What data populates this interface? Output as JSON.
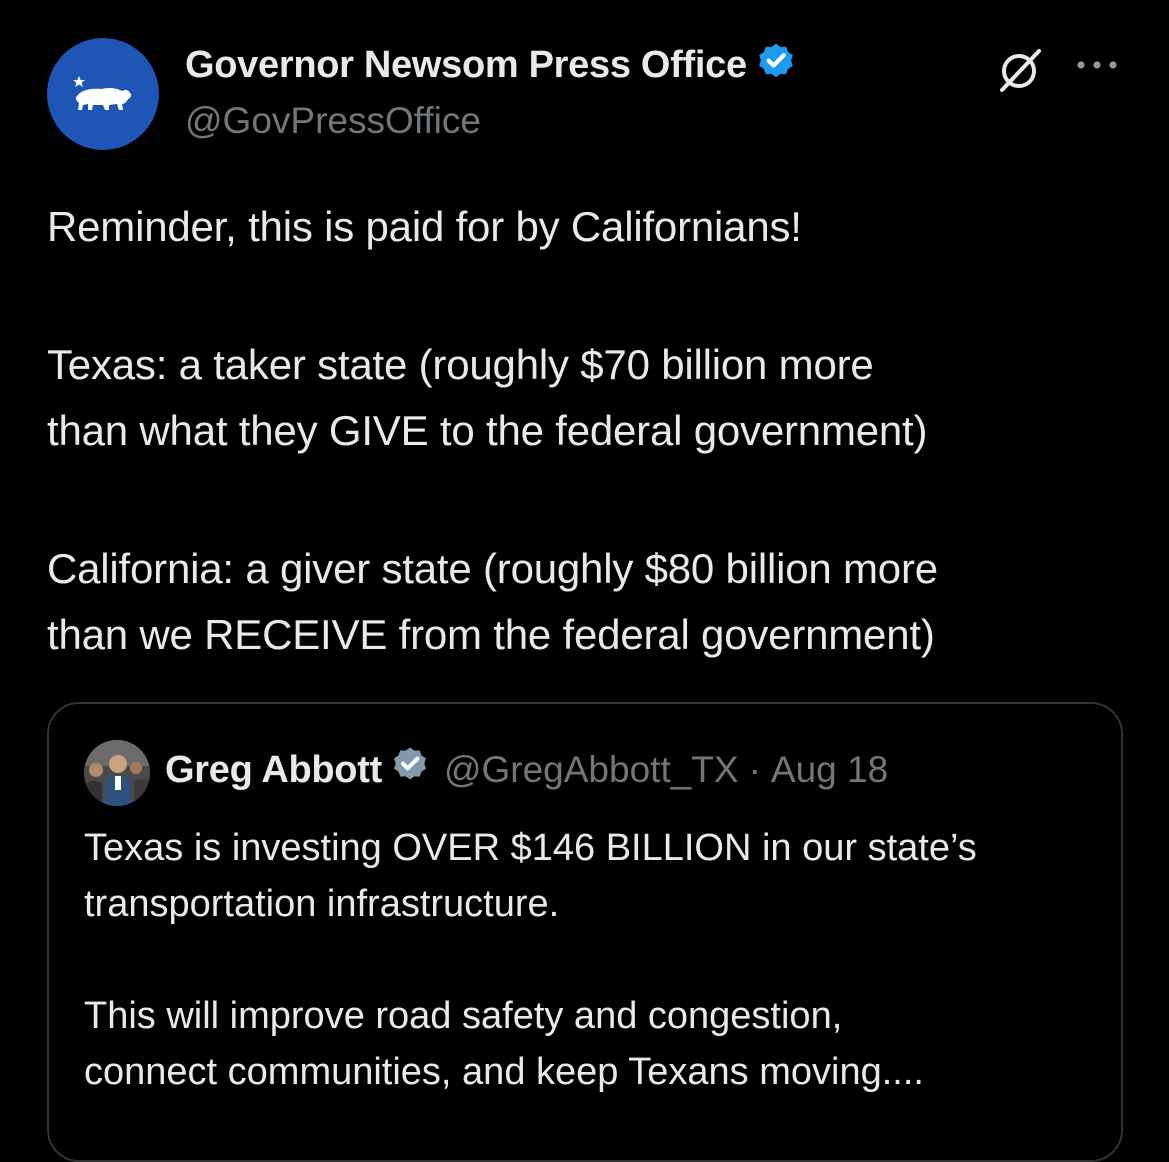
{
  "author": {
    "display_name": "Governor Newsom Press Office",
    "handle": "@GovPressOffice"
  },
  "tweet": {
    "lines": [
      "Reminder, this is paid for by Californians!",
      "Texas: a taker state (roughly $70 billion more",
      "than what they GIVE to the federal government)",
      "California: a giver state (roughly $80 billion more",
      "than we RECEIVE from the federal government)"
    ]
  },
  "quote": {
    "display_name": "Greg Abbott",
    "handle": "@GregAbbott_TX",
    "separator": "·",
    "date": "Aug 18",
    "lines": [
      "Texas is investing OVER $146 BILLION in our state’s",
      "transportation infrastructure.",
      "This will improve road safety and congestion,",
      "connect communities, and keep Texans moving...."
    ]
  },
  "icons": {
    "avatar": "california-bear-icon",
    "verified": "blue-verified-badge-icon",
    "quote_verified": "gray-verified-badge-icon",
    "grok": "grok-icon",
    "more": "more-options-icon"
  },
  "colors": {
    "background": "#000000",
    "primary_text": "#e7e9ea",
    "secondary_text": "#71767b",
    "verified_blue": "#1d9bf0",
    "verified_gray": "#829aab",
    "avatar_blue": "#1f55b5",
    "border": "#2f3336"
  }
}
